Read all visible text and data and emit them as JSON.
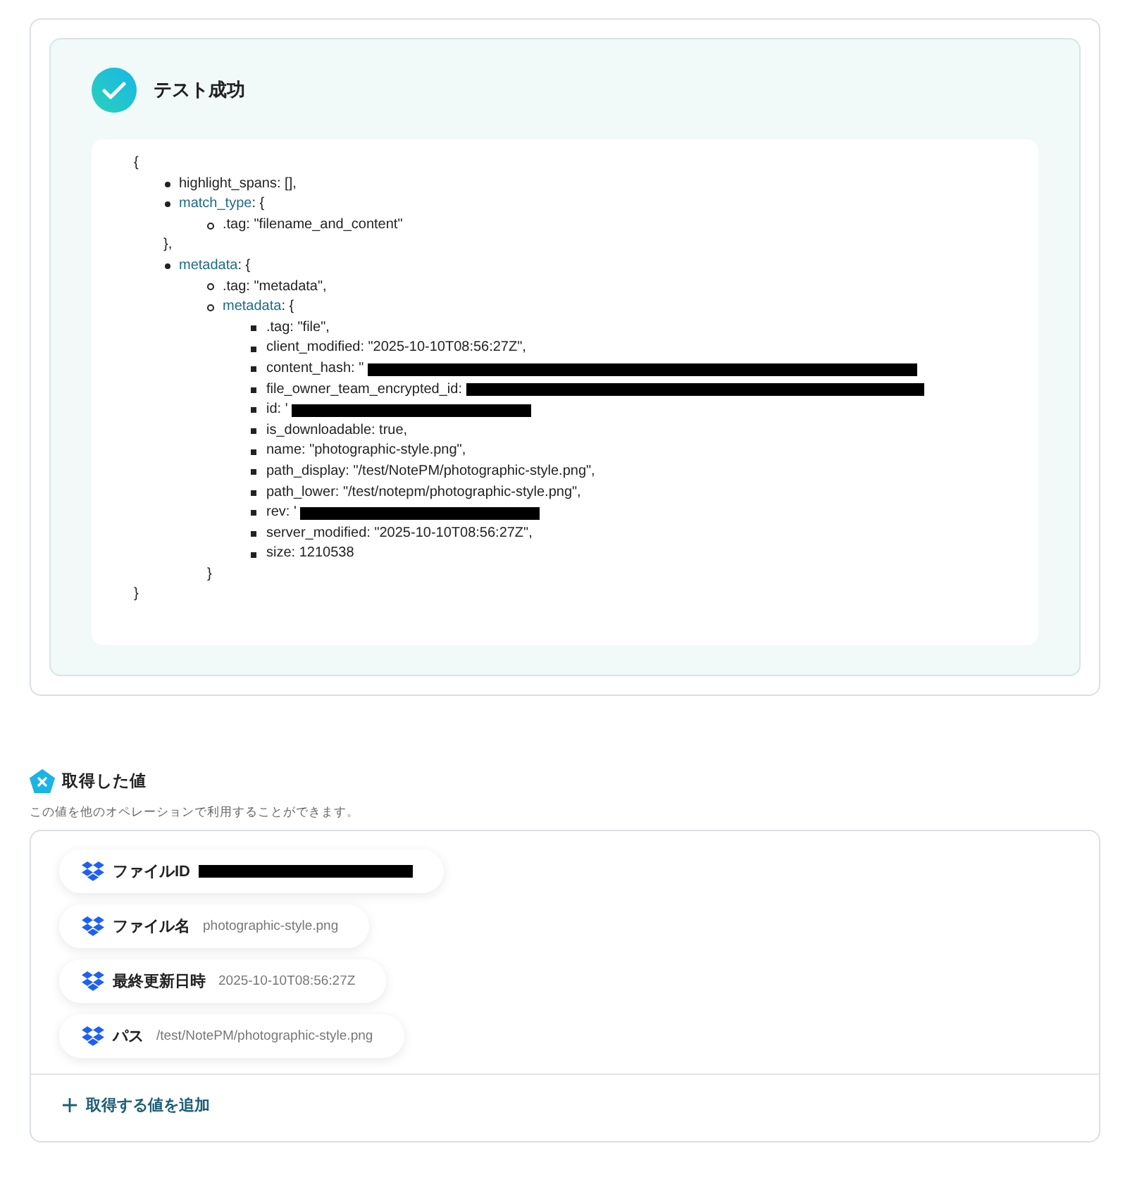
{
  "test_result": {
    "success": true,
    "title": "テスト成功",
    "open": "{",
    "close": "}",
    "lines": [
      {
        "text": "highlight_spans: [],"
      },
      {
        "key": "match_type",
        "text": ": {",
        "close": "},",
        "children": [
          {
            "text": ".tag: \"filename_and_content\""
          }
        ]
      },
      {
        "key": "metadata",
        "text": ": {",
        "children": [
          {
            "text": ".tag: \"metadata\","
          },
          {
            "key": "metadata",
            "text": ": {",
            "close": "}",
            "children": [
              {
                "text": ".tag: \"file\","
              },
              {
                "text": "client_modified: \"2025-10-10T08:56:27Z\","
              },
              {
                "text": "content_hash: \"",
                "redacted": true
              },
              {
                "text": "file_owner_team_encrypted_id:",
                "redacted": true
              },
              {
                "text": "id: '",
                "redacted": true
              },
              {
                "text": "is_downloadable: true,"
              },
              {
                "text": "name: \"photographic-style.png\","
              },
              {
                "text": "path_display: \"/test/NotePM/photographic-style.png\","
              },
              {
                "text": "path_lower: \"/test/notepm/photographic-style.png\","
              },
              {
                "text": "rev: '",
                "redacted": true
              },
              {
                "text": "server_modified: \"2025-10-10T08:56:27Z\","
              },
              {
                "text": "size: 1210538"
              }
            ]
          }
        ]
      }
    ]
  },
  "values": {
    "title": "取得した値",
    "description": "この値を他のオペレーションで利用することができます。",
    "items": [
      {
        "label": "ファイルID",
        "redacted": true
      },
      {
        "label": "ファイル名",
        "value": "photographic-style.png"
      },
      {
        "label": "最終更新日時",
        "value": "2025-10-10T08:56:27Z"
      },
      {
        "label": "パス",
        "value": "/test/NotePM/photographic-style.png"
      }
    ],
    "add_button": "取得する値を追加"
  }
}
